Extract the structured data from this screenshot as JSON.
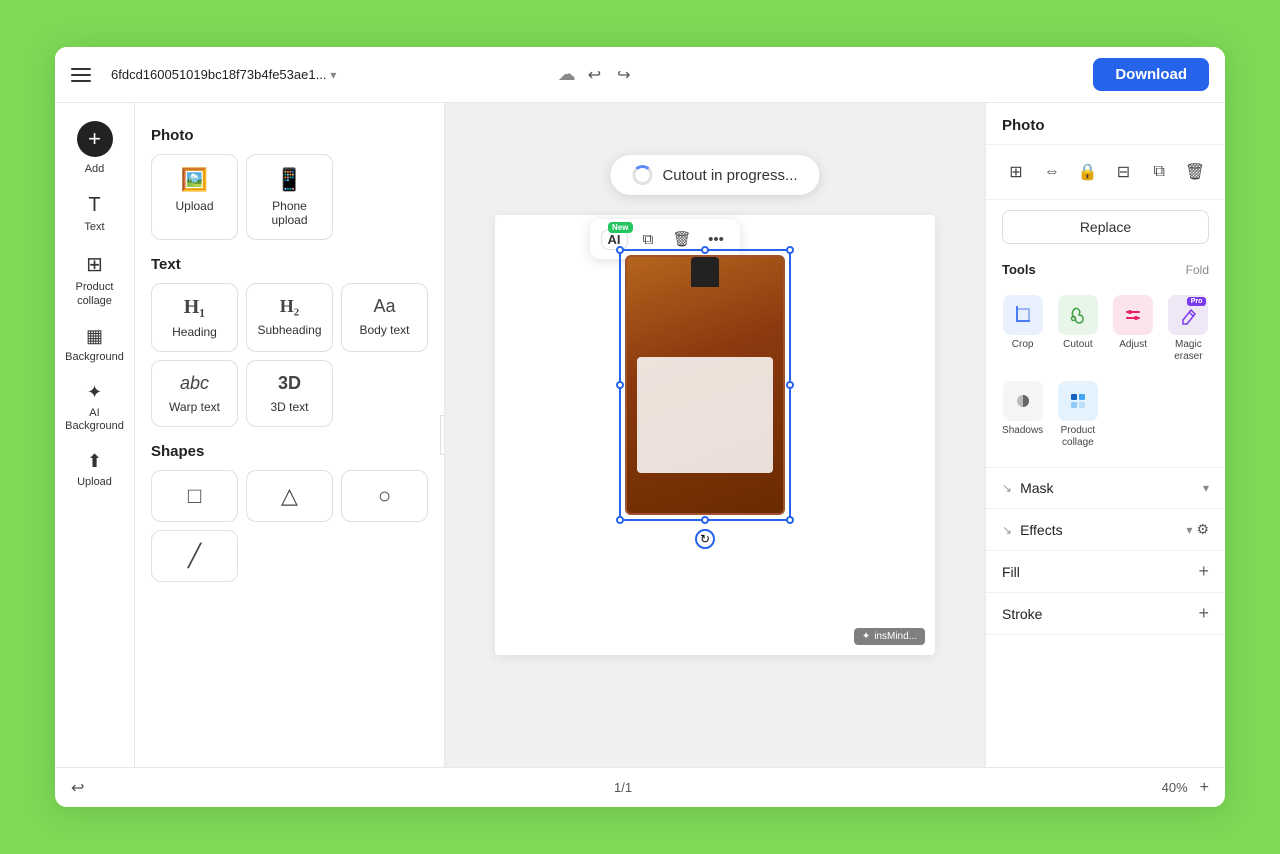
{
  "header": {
    "menu_label": "Menu",
    "title": "6fdcd160051019bc18f73b4fe53ae1...",
    "download_label": "Download",
    "undo_symbol": "↩",
    "redo_symbol": "↪",
    "cloud_symbol": "☁"
  },
  "left_icon_sidebar": {
    "add_label": "Add",
    "items": [
      {
        "id": "text",
        "label": "Text",
        "icon": "T"
      },
      {
        "id": "product-collage",
        "label": "Product collage",
        "icon": "⊞"
      },
      {
        "id": "background",
        "label": "Background",
        "icon": "⊘"
      },
      {
        "id": "ai-background",
        "label": "AI Background",
        "icon": "✦"
      },
      {
        "id": "upload",
        "label": "Upload",
        "icon": "⬆"
      }
    ]
  },
  "left_panel": {
    "photo_section": {
      "title": "Photo",
      "items": [
        {
          "id": "upload",
          "label": "Upload",
          "icon": "🖼"
        },
        {
          "id": "phone-upload",
          "label": "Phone upload",
          "icon": "📱"
        }
      ]
    },
    "text_section": {
      "title": "Text",
      "items": [
        {
          "id": "heading",
          "label": "Heading",
          "icon": "H1"
        },
        {
          "id": "subheading",
          "label": "Subheading",
          "icon": "H2"
        },
        {
          "id": "body-text",
          "label": "Body text",
          "icon": "Aa"
        },
        {
          "id": "warp-text",
          "label": "Warp text",
          "icon": "abc"
        },
        {
          "id": "3d-text",
          "label": "3D text",
          "icon": "3D"
        }
      ]
    },
    "shapes_section": {
      "title": "Shapes",
      "items": [
        {
          "id": "rectangle",
          "label": "Rectangle",
          "icon": "□"
        },
        {
          "id": "triangle",
          "label": "Triangle",
          "icon": "△"
        },
        {
          "id": "circle",
          "label": "Circle",
          "icon": "○"
        },
        {
          "id": "line",
          "label": "Line",
          "icon": "╱"
        }
      ]
    }
  },
  "canvas": {
    "cutout_banner": "Cutout in progress..."
  },
  "right_panel": {
    "title": "Photo",
    "tools": [
      {
        "id": "layers",
        "icon": "⊞",
        "label": "Layers"
      },
      {
        "id": "flip",
        "icon": "⇔",
        "label": "Flip"
      },
      {
        "id": "lock",
        "icon": "🔒",
        "label": "Lock"
      },
      {
        "id": "align",
        "icon": "⊟",
        "label": "Align"
      },
      {
        "id": "duplicate",
        "icon": "⧉",
        "label": "Duplicate"
      },
      {
        "id": "delete",
        "icon": "🗑",
        "label": "Delete"
      }
    ],
    "replace_label": "Replace",
    "tools_section_title": "Tools",
    "fold_label": "Fold",
    "grid_tools": [
      {
        "id": "crop",
        "label": "Crop",
        "icon": "⊡",
        "bg": "#e8f0fe"
      },
      {
        "id": "cutout",
        "label": "Cutout",
        "icon": "✂",
        "bg": "#e8f5e9"
      },
      {
        "id": "adjust",
        "label": "Adjust",
        "icon": "≡",
        "bg": "#fce4ec"
      },
      {
        "id": "magic-eraser",
        "label": "Magic eraser",
        "icon": "✦",
        "bg": "#ede7f6"
      },
      {
        "id": "shadows",
        "label": "Shadows",
        "icon": "◐",
        "bg": "#f5f5f5"
      },
      {
        "id": "product-collage",
        "label": "Product collage",
        "icon": "⊞",
        "bg": "#e3f2fd"
      }
    ],
    "mask_label": "Mask",
    "effects_label": "Effects",
    "fill_label": "Fill",
    "stroke_label": "Stroke"
  },
  "float_toolbar": {
    "ai_label": "AI",
    "new_badge": "New",
    "copy_icon": "⧉",
    "delete_icon": "🗑",
    "more_icon": "•••"
  },
  "insmind_badge": "insMind...",
  "bottom_bar": {
    "undo_icon": "↩",
    "page_info": "1/1",
    "zoom_level": "40%"
  }
}
